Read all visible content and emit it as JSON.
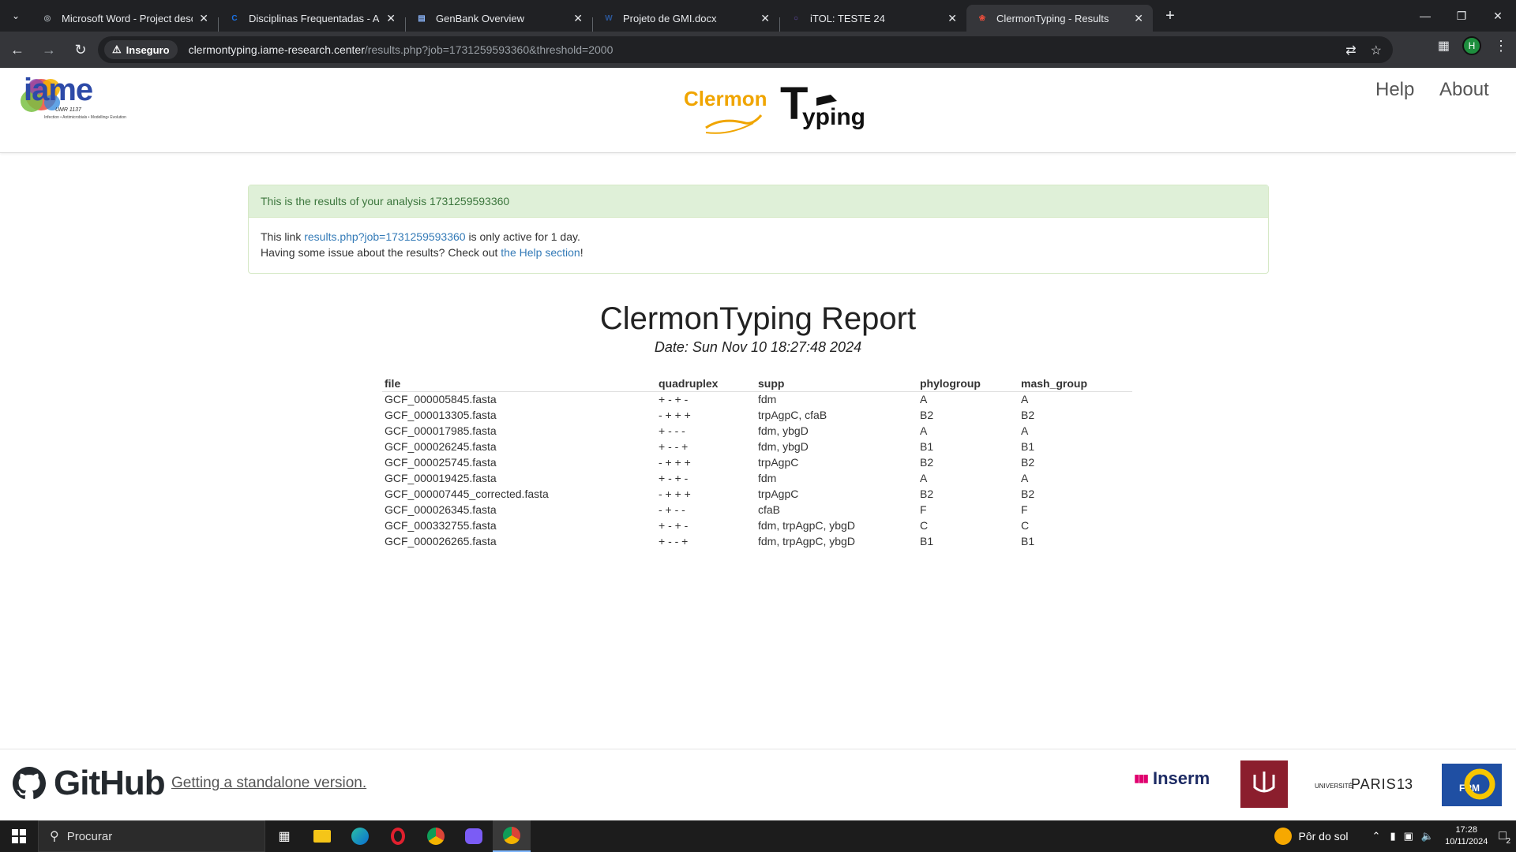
{
  "browser": {
    "tabs": [
      {
        "title": "Microsoft Word - Project descri",
        "favicon": "globe-icon",
        "active": false
      },
      {
        "title": "Disciplinas Frequentadas - Alun",
        "favicon": "c-icon",
        "active": false
      },
      {
        "title": "GenBank Overview",
        "favicon": "doc-icon",
        "active": false
      },
      {
        "title": "Projeto de GMI.docx",
        "favicon": "word-icon",
        "active": false
      },
      {
        "title": "iTOL: TESTE 24",
        "favicon": "itol-icon",
        "active": false
      },
      {
        "title": "ClermonTyping - Results",
        "favicon": "clermont-icon",
        "active": true
      }
    ],
    "security_label": "Inseguro",
    "url_host": "clermontyping.iame-research.center",
    "url_rest": "/results.php?job=1731259593360&threshold=2000",
    "profile_initial": "H"
  },
  "site": {
    "iame_logo_text": "iame",
    "iame_umr": "UMR 1137",
    "iame_tagline": "Infection • Antimicrobials • Modelling• Evolution",
    "logo_part1": "Clermon",
    "logo_part2": "yping",
    "nav": {
      "help": "Help",
      "about": "About"
    }
  },
  "panel": {
    "heading": "This is the results of your analysis 1731259593360",
    "line1_pre": "This link ",
    "line1_link": "results.php?job=1731259593360",
    "line1_post": " is only active for 1 day.",
    "line2_pre": "Having some issue about the results? Check out ",
    "line2_link": "the Help section",
    "line2_post": "!"
  },
  "report": {
    "title": "ClermonTyping Report",
    "date": "Date: Sun Nov 10 18:27:48 2024",
    "columns": [
      "file",
      "quadruplex",
      "supp",
      "phylogroup",
      "mash_group"
    ],
    "rows": [
      [
        "GCF_000005845.fasta",
        "+ - + -",
        "fdm",
        "A",
        "A"
      ],
      [
        "GCF_000013305.fasta",
        "- + + +",
        "trpAgpC, cfaB",
        "B2",
        "B2"
      ],
      [
        "GCF_000017985.fasta",
        "+ - - -",
        "fdm, ybgD",
        "A",
        "A"
      ],
      [
        "GCF_000026245.fasta",
        "+ - - +",
        "fdm, ybgD",
        "B1",
        "B1"
      ],
      [
        "GCF_000025745.fasta",
        "- + + +",
        "trpAgpC",
        "B2",
        "B2"
      ],
      [
        "GCF_000019425.fasta",
        "+ - + -",
        "fdm",
        "A",
        "A"
      ],
      [
        "GCF_000007445_corrected.fasta",
        "- + + +",
        "trpAgpC",
        "B2",
        "B2"
      ],
      [
        "GCF_000026345.fasta",
        "- + - -",
        "cfaB",
        "F",
        "F"
      ],
      [
        "GCF_000332755.fasta",
        "+ - + -",
        "fdm, trpAgpC, ybgD",
        "C",
        "C"
      ],
      [
        "GCF_000026265.fasta",
        "+ - - +",
        "fdm, trpAgpC, ybgD",
        "B1",
        "B1"
      ]
    ]
  },
  "footer": {
    "github_word": "GitHub",
    "standalone_link": "Getting a standalone version.",
    "partners": {
      "inserm": "Inserm",
      "paris13_a": "UNIVERSITÉ",
      "paris13_b": "PARIS",
      "paris13_c": "13",
      "frm": "FRM"
    }
  },
  "taskbar": {
    "search_placeholder": "Procurar",
    "weather": "Pôr do sol",
    "time": "17:28",
    "date": "10/11/2024",
    "notifications": "2"
  },
  "colors": {
    "panel_bg": "#dff0d8",
    "panel_text": "#3c763d",
    "link": "#337ab7",
    "logo_orange": "#f0a500"
  }
}
